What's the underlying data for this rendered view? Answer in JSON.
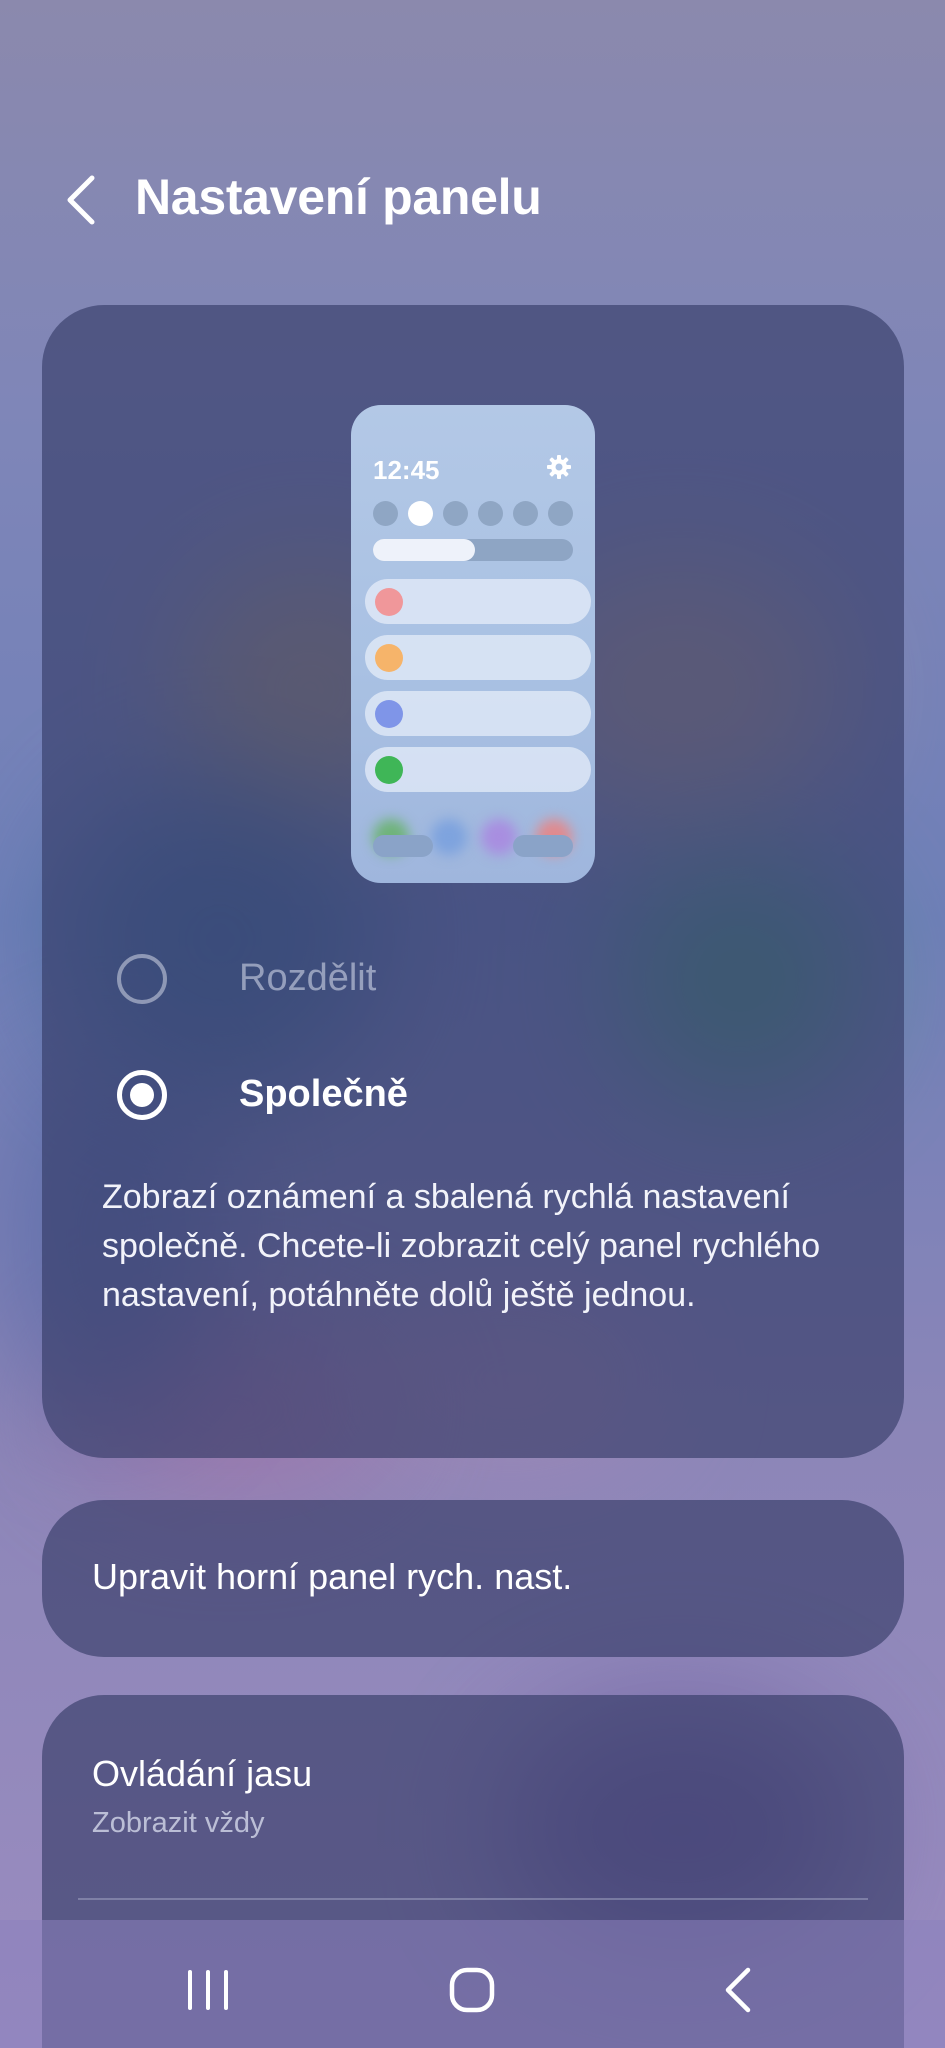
{
  "header": {
    "title": "Nastavení panelu",
    "back_icon": "chevron-left-icon"
  },
  "preview": {
    "time": "12:45",
    "gear_icon": "gear-icon",
    "row_colors": [
      "#f0979a",
      "#f6b46a",
      "#7f95e8",
      "#3fb657"
    ]
  },
  "options": [
    {
      "label": "Rozdělit",
      "selected": false
    },
    {
      "label": "Společně",
      "selected": true
    }
  ],
  "description": "Zobrazí oznámení a sbalená rychlá nastavení společně. Chcete-li zobrazit celý panel rychlého nastavení, potáhněte dolů ještě jednou.",
  "edit_panel": {
    "title": "Upravit horní panel rych. nast."
  },
  "brightness": {
    "title": "Ovládání jasu",
    "subtitle": "Zobrazit vždy"
  },
  "nav": {
    "recents_icon": "recents-icon",
    "home_icon": "home-icon",
    "back_icon": "back-icon"
  }
}
